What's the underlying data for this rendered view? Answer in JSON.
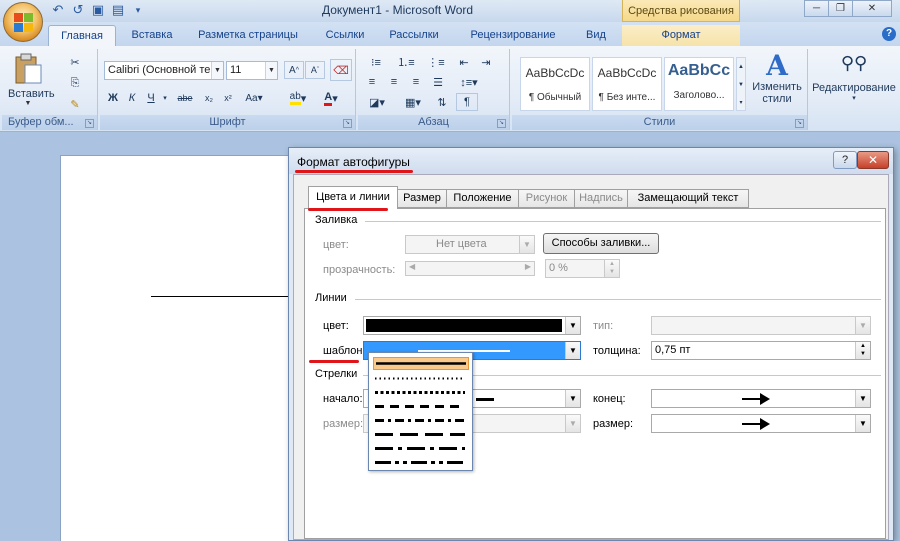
{
  "window": {
    "title": "Документ1 - Microsoft Word",
    "context_tab_group": "Средства рисования"
  },
  "ribbon_tabs": [
    "Главная",
    "Вставка",
    "Разметка страницы",
    "Ссылки",
    "Рассылки",
    "Рецензирование",
    "Вид",
    "Формат"
  ],
  "ribbon": {
    "clipboard": {
      "paste_label": "Вставить",
      "group_label": "Буфер обм..."
    },
    "font": {
      "font_name": "Calibri (Основной те",
      "font_size": "11",
      "group_label": "Шрифт"
    },
    "paragraph": {
      "group_label": "Абзац"
    },
    "styles": {
      "items": [
        {
          "sample": "AaBbCcDc",
          "name": "¶ Обычный"
        },
        {
          "sample": "AaBbCcDc",
          "name": "¶ Без инте..."
        },
        {
          "sample": "AaBbCc",
          "name": "Заголово..."
        }
      ],
      "change_styles_label_1": "Изменить",
      "change_styles_label_2": "стили",
      "group_label": "Стили"
    },
    "editing": {
      "label": "Редактирование"
    }
  },
  "dialog": {
    "title": "Формат автофигуры",
    "help": "?",
    "close": "✕",
    "tabs": [
      {
        "label": "Цвета и линии",
        "active": true,
        "disabled": false
      },
      {
        "label": "Размер",
        "active": false,
        "disabled": false
      },
      {
        "label": "Положение",
        "active": false,
        "disabled": false
      },
      {
        "label": "Рисунок",
        "active": false,
        "disabled": true
      },
      {
        "label": "Надпись",
        "active": false,
        "disabled": true
      },
      {
        "label": "Замещающий текст",
        "active": false,
        "disabled": false
      }
    ],
    "fill": {
      "section_label": "Заливка",
      "color_label": "цвет:",
      "color_value": "Нет цвета",
      "fill_effects_button": "Способы заливки...",
      "transparency_label": "прозрачность:",
      "transparency_value": "0 %"
    },
    "lines": {
      "section_label": "Линии",
      "color_label": "цвет:",
      "color_swatch": "#000000",
      "type_label": "тип:",
      "pattern_label": "шаблон:",
      "weight_label": "толщина:",
      "weight_value": "0,75 пт"
    },
    "arrows": {
      "section_label": "Стрелки",
      "begin_label": "начало:",
      "end_label": "конец:",
      "begin_size_label": "размер:",
      "end_size_label": "размер:"
    },
    "dash_options": [
      "solid",
      "round-dot",
      "square-dot",
      "dash",
      "dash-dot",
      "long-dash",
      "long-dash-dot",
      "long-dash-dot-dot"
    ],
    "selected_dash": "solid",
    "highlight_color": "#e0151a",
    "selection_color": "#3399ff"
  }
}
